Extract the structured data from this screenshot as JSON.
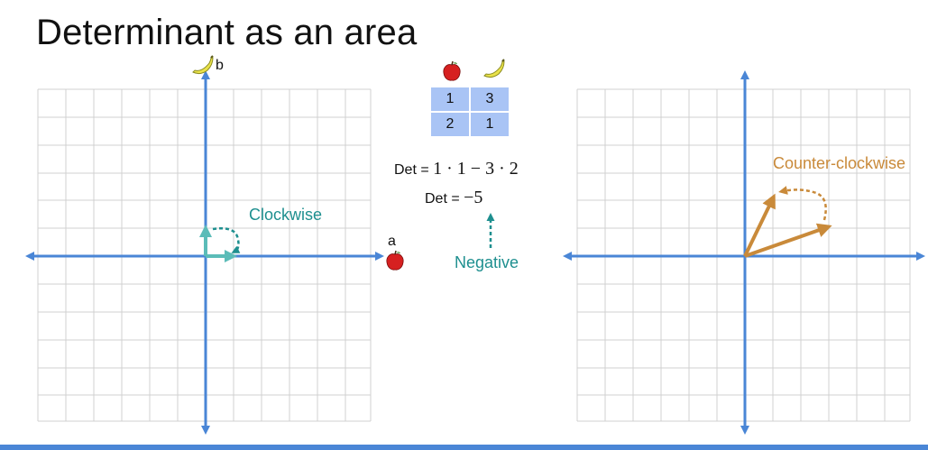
{
  "title": "Determinant as an area",
  "colors": {
    "axis": "#4a86d6",
    "grid": "#d0d0d0",
    "teal": "#1e8f8f",
    "orange": "#c98a3a",
    "table_fill": "#a9c4f5",
    "accent_bar": "#4a86d6"
  },
  "left_plot": {
    "x_axis_letter": "a",
    "y_axis_letter": "b",
    "x_icon": "apple-icon",
    "y_icon": "banana-icon",
    "rotation_label": "Clockwise"
  },
  "matrix": {
    "header_icons": [
      "apple-icon",
      "banana-icon"
    ],
    "rows": [
      [
        "1",
        "3"
      ],
      [
        "2",
        "1"
      ]
    ]
  },
  "equation1": {
    "prefix": "Det = ",
    "expr": "1 · 1 − 3 · 2"
  },
  "equation2": {
    "prefix": "Det = ",
    "expr": "−5"
  },
  "sign_label": "Negative",
  "right_plot": {
    "rotation_label": "Counter-clockwise"
  }
}
